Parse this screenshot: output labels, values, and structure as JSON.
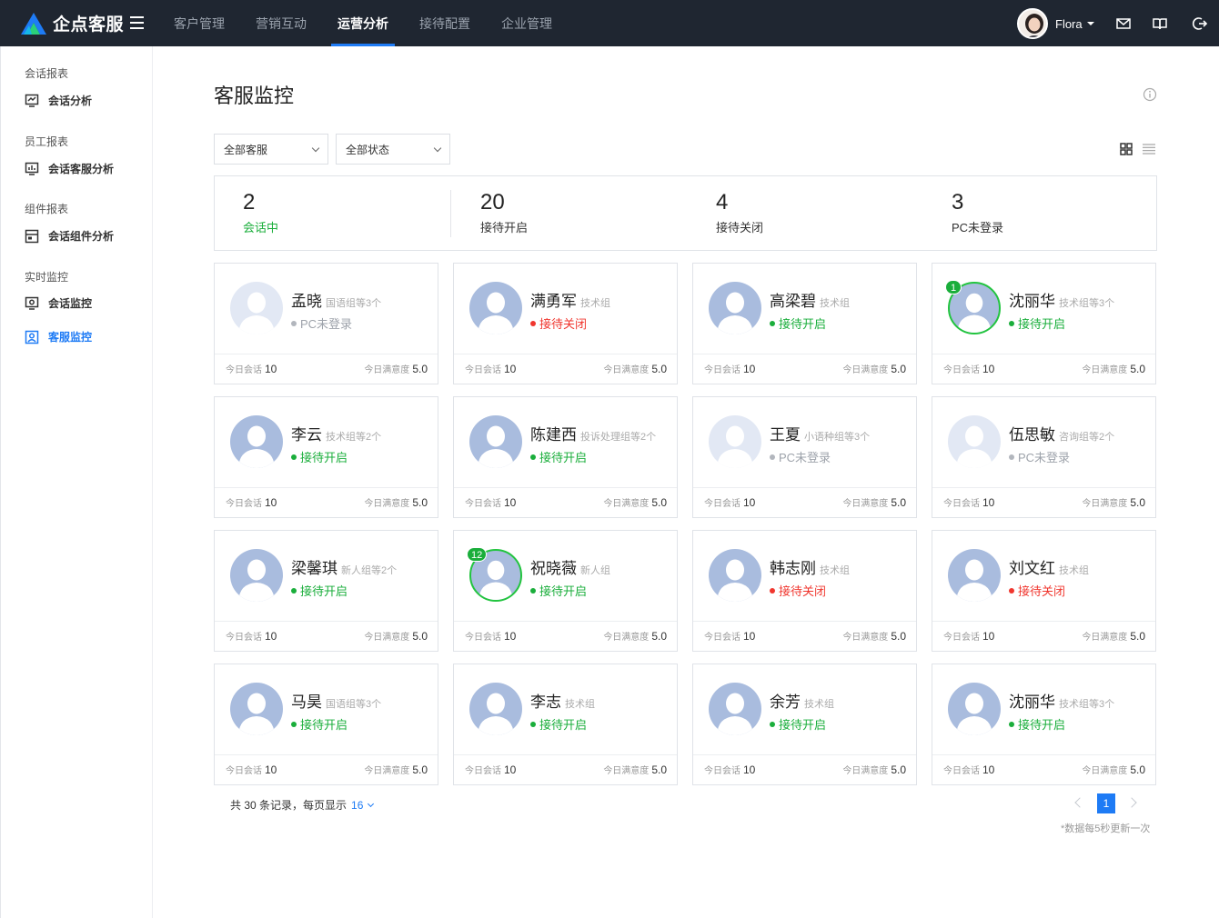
{
  "app": {
    "name": "企点客服"
  },
  "nav": {
    "items": [
      "客户管理",
      "营销互动",
      "运营分析",
      "接待配置",
      "企业管理"
    ],
    "active_index": 2
  },
  "user": {
    "name": "Flora"
  },
  "sidebar": {
    "groups": [
      {
        "title": "会话报表",
        "items": [
          "会话分析"
        ]
      },
      {
        "title": "员工报表",
        "items": [
          "会话客服分析"
        ]
      },
      {
        "title": "组件报表",
        "items": [
          "会话组件分析"
        ]
      },
      {
        "title": "实时监控",
        "items": [
          "会话监控",
          "客服监控"
        ]
      }
    ],
    "active_item": "客服监控"
  },
  "page": {
    "title": "客服监控"
  },
  "filters": {
    "agent": "全部客服",
    "status": "全部状态"
  },
  "stats": [
    {
      "value": "2",
      "label": "会话中"
    },
    {
      "value": "20",
      "label": "接待开启"
    },
    {
      "value": "4",
      "label": "接待关闭"
    },
    {
      "value": "3",
      "label": "PC未登录"
    }
  ],
  "card_labels": {
    "sessions": "今日会话",
    "satisfaction": "今日满意度"
  },
  "agents": [
    {
      "name": "孟晓",
      "group": "国语组等3个",
      "status": "PC未登录",
      "state": "offline",
      "sessions": "10",
      "satisfaction": "5.0",
      "badge": ""
    },
    {
      "name": "满勇军",
      "group": "技术组",
      "status": "接待关闭",
      "state": "closed",
      "sessions": "10",
      "satisfaction": "5.0",
      "badge": ""
    },
    {
      "name": "高梁碧",
      "group": "技术组",
      "status": "接待开启",
      "state": "open",
      "sessions": "10",
      "satisfaction": "5.0",
      "badge": ""
    },
    {
      "name": "沈丽华",
      "group": "技术组等3个",
      "status": "接待开启",
      "state": "open",
      "sessions": "10",
      "satisfaction": "5.0",
      "badge": "1"
    },
    {
      "name": "李云",
      "group": "技术组等2个",
      "status": "接待开启",
      "state": "open",
      "sessions": "10",
      "satisfaction": "5.0",
      "badge": ""
    },
    {
      "name": "陈建西",
      "group": "投诉处理组等2个",
      "status": "接待开启",
      "state": "open",
      "sessions": "10",
      "satisfaction": "5.0",
      "badge": ""
    },
    {
      "name": "王夏",
      "group": "小语种组等3个",
      "status": "PC未登录",
      "state": "offline",
      "sessions": "10",
      "satisfaction": "5.0",
      "badge": ""
    },
    {
      "name": "伍思敏",
      "group": "咨询组等2个",
      "status": "PC未登录",
      "state": "offline",
      "sessions": "10",
      "satisfaction": "5.0",
      "badge": ""
    },
    {
      "name": "梁馨琪",
      "group": "新人组等2个",
      "status": "接待开启",
      "state": "open",
      "sessions": "10",
      "satisfaction": "5.0",
      "badge": ""
    },
    {
      "name": "祝晓薇",
      "group": "新人组",
      "status": "接待开启",
      "state": "open",
      "sessions": "10",
      "satisfaction": "5.0",
      "badge": "12"
    },
    {
      "name": "韩志刚",
      "group": "技术组",
      "status": "接待关闭",
      "state": "closed",
      "sessions": "10",
      "satisfaction": "5.0",
      "badge": ""
    },
    {
      "name": "刘文红",
      "group": "技术组",
      "status": "接待关闭",
      "state": "closed",
      "sessions": "10",
      "satisfaction": "5.0",
      "badge": ""
    },
    {
      "name": "马昊",
      "group": "国语组等3个",
      "status": "接待开启",
      "state": "open",
      "sessions": "10",
      "satisfaction": "5.0",
      "badge": ""
    },
    {
      "name": "李志",
      "group": "技术组",
      "status": "接待开启",
      "state": "open",
      "sessions": "10",
      "satisfaction": "5.0",
      "badge": ""
    },
    {
      "name": "余芳",
      "group": "技术组",
      "status": "接待开启",
      "state": "open",
      "sessions": "10",
      "satisfaction": "5.0",
      "badge": ""
    },
    {
      "name": "沈丽华",
      "group": "技术组等3个",
      "status": "接待开启",
      "state": "open",
      "sessions": "10",
      "satisfaction": "5.0",
      "badge": ""
    }
  ],
  "pagination": {
    "summary": "共 30 条记录，每页显示",
    "page_size": "16",
    "current_page": "1",
    "note": "*数据每5秒更新一次"
  },
  "colors": {
    "topbar": "#1f2631",
    "accent": "#1e7bf5",
    "open": "#1aae3b",
    "closed": "#f0362e",
    "offline": "#9ea3ab"
  }
}
